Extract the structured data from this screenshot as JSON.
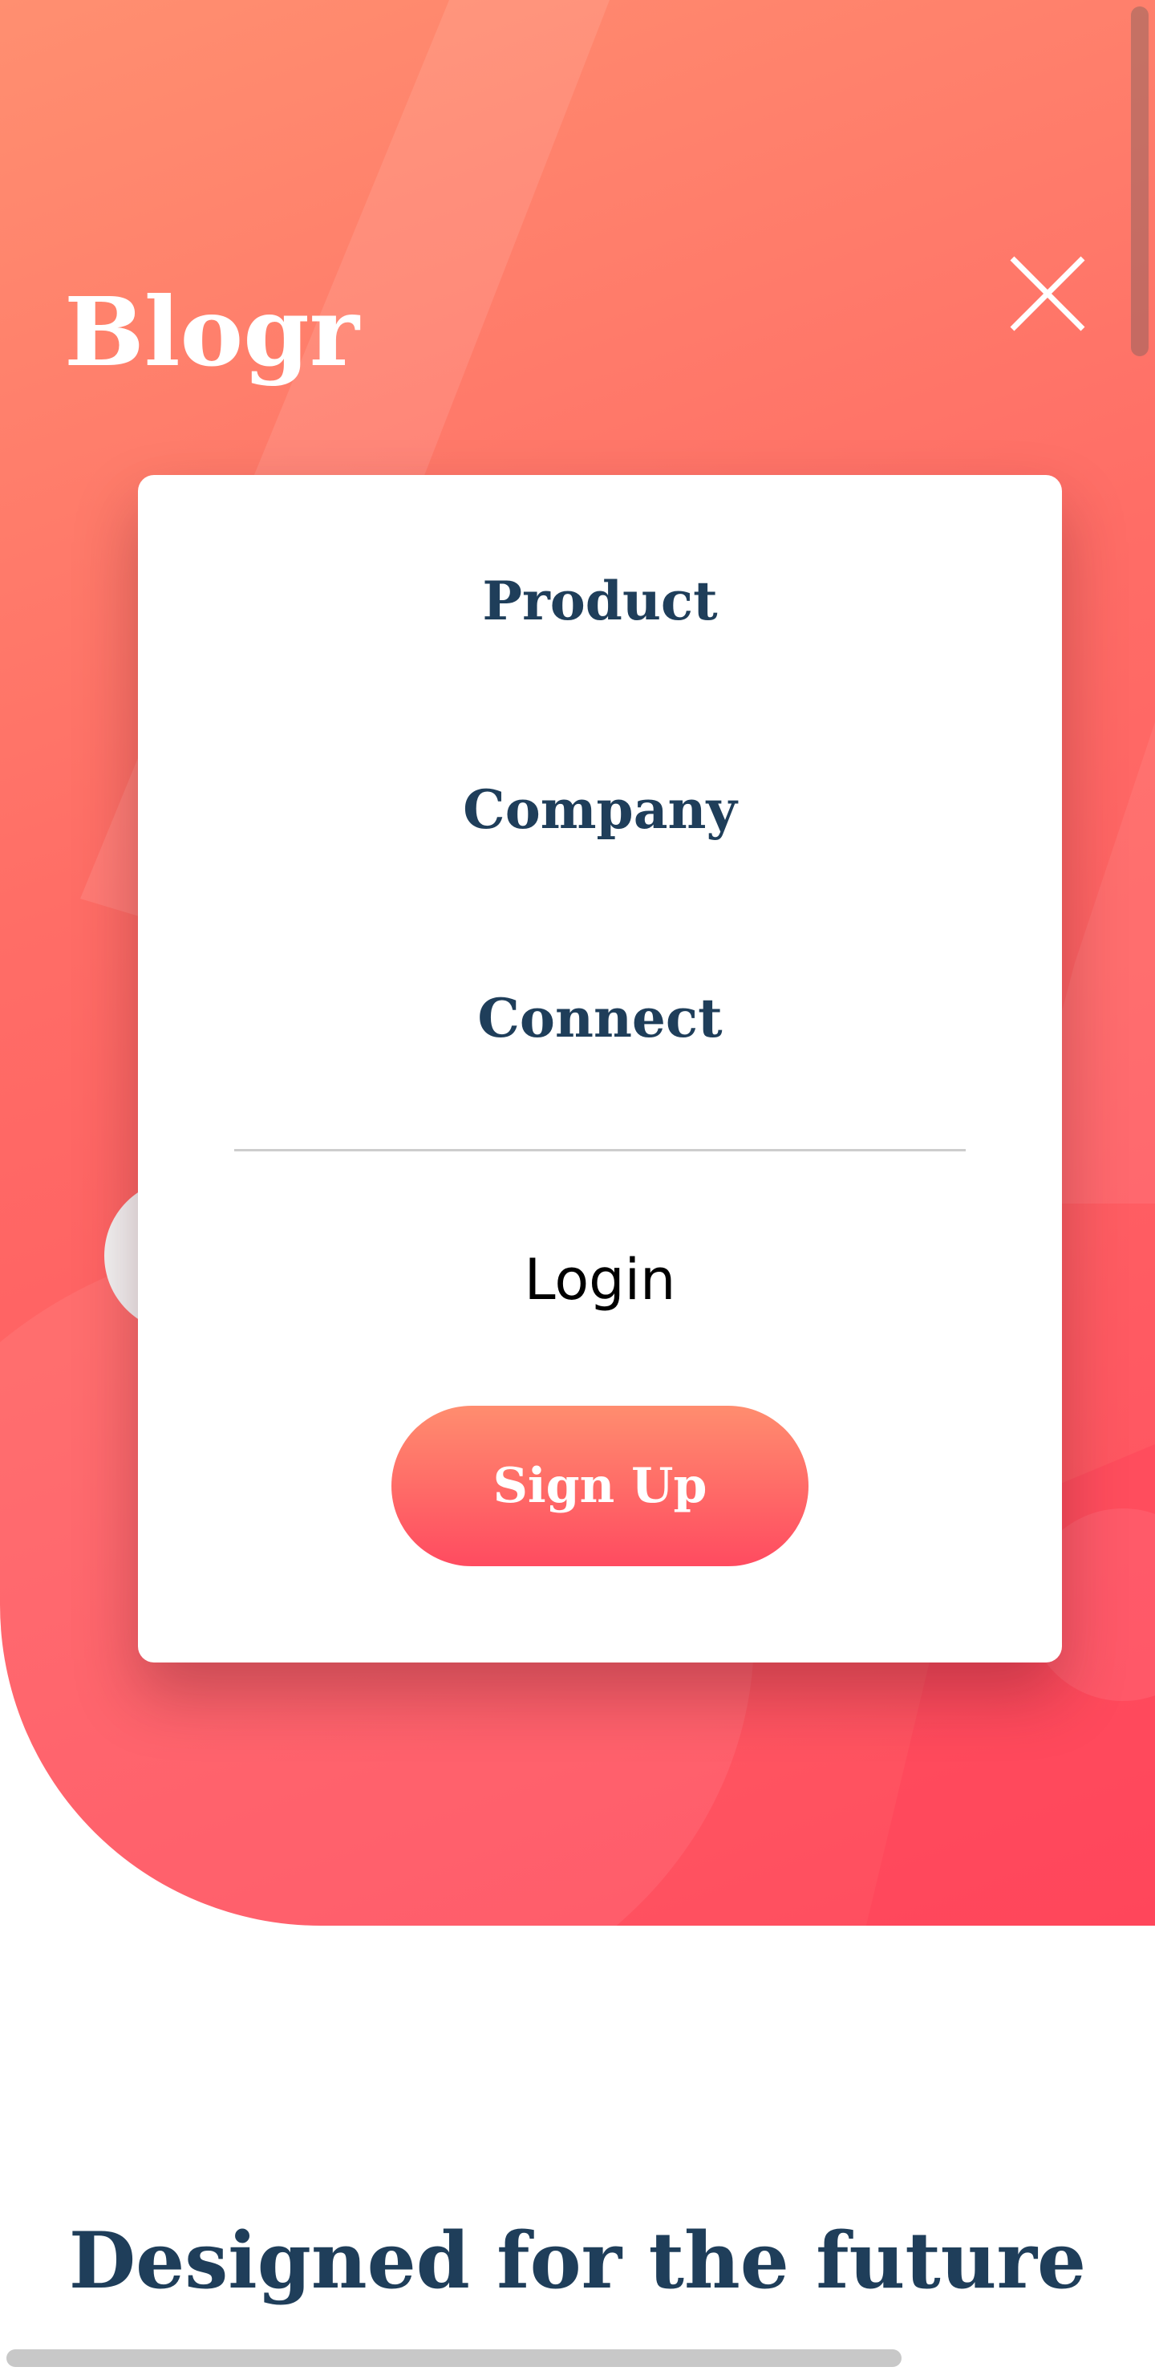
{
  "header": {
    "logo": "Blogr",
    "close_icon": "close-icon"
  },
  "menu": {
    "items": [
      {
        "label": "Product"
      },
      {
        "label": "Company"
      },
      {
        "label": "Connect"
      }
    ],
    "login_label": "Login",
    "signup_label": "Sign Up"
  },
  "section": {
    "heading": "Designed for the future"
  },
  "colors": {
    "hero_gradient_start": "#ff8f70",
    "hero_gradient_end": "#ff4c5f",
    "heading_text": "#1f3e5a",
    "menu_background": "#ffffff"
  }
}
